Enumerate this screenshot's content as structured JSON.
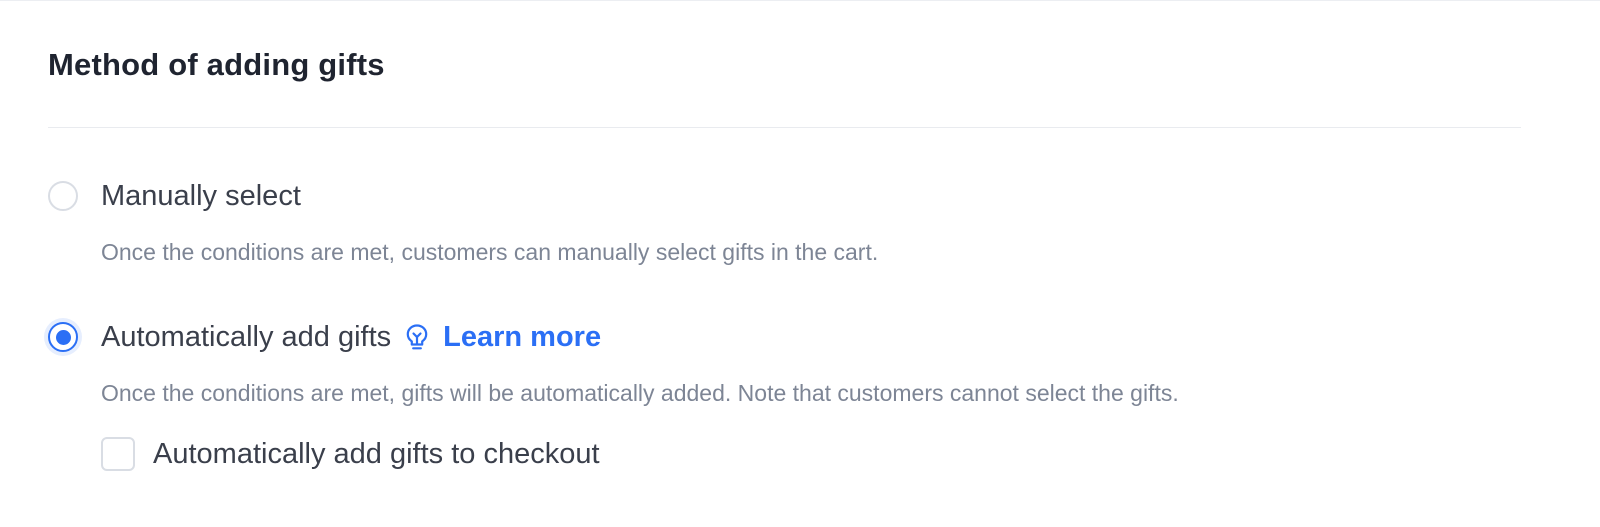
{
  "section": {
    "title": "Method of adding gifts"
  },
  "options": [
    {
      "label": "Manually select",
      "description": "Once the conditions are met, customers can manually select gifts in the cart.",
      "selected": false
    },
    {
      "label": "Automatically add gifts",
      "link_label": "Learn more",
      "link_icon": "lightbulb-icon",
      "description": "Once the conditions are met, gifts will be automatically added. Note that customers cannot select the gifts.",
      "selected": true
    }
  ],
  "checkout_option": {
    "label": "Automatically add gifts to checkout",
    "checked": false
  },
  "colors": {
    "accent": "#2b6ff5",
    "title": "#1f2430",
    "label": "#3a3f4b",
    "description": "#7d8595",
    "border": "#d9dde4"
  }
}
